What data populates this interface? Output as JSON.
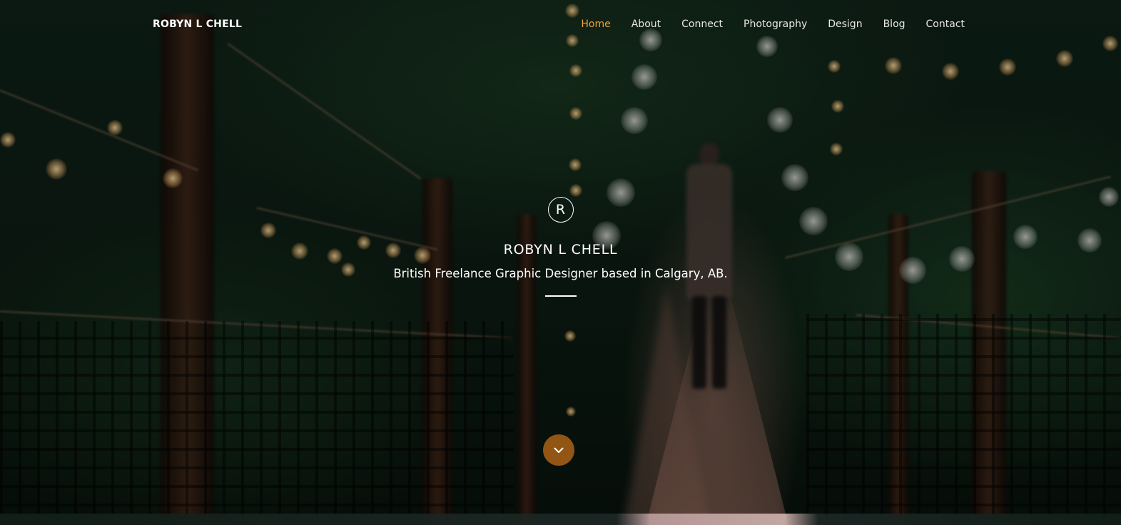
{
  "brand": {
    "name": "ROBYN L CHELL"
  },
  "nav": {
    "items": [
      {
        "label": "Home",
        "active": true
      },
      {
        "label": "About",
        "active": false
      },
      {
        "label": "Connect",
        "active": false
      },
      {
        "label": "Photography",
        "active": false
      },
      {
        "label": "Design",
        "active": false
      },
      {
        "label": "Blog",
        "active": false
      },
      {
        "label": "Contact",
        "active": false
      }
    ]
  },
  "hero": {
    "logo_letter": "R",
    "title": "ROBYN L CHELL",
    "subtitle": "British Freelance Graphic Designer based in Calgary, AB.",
    "scroll_icon": "chevron-down-icon"
  },
  "colors": {
    "accent": "#f0a03c",
    "scroll_button": "#a66016",
    "text": "#ffffff"
  }
}
